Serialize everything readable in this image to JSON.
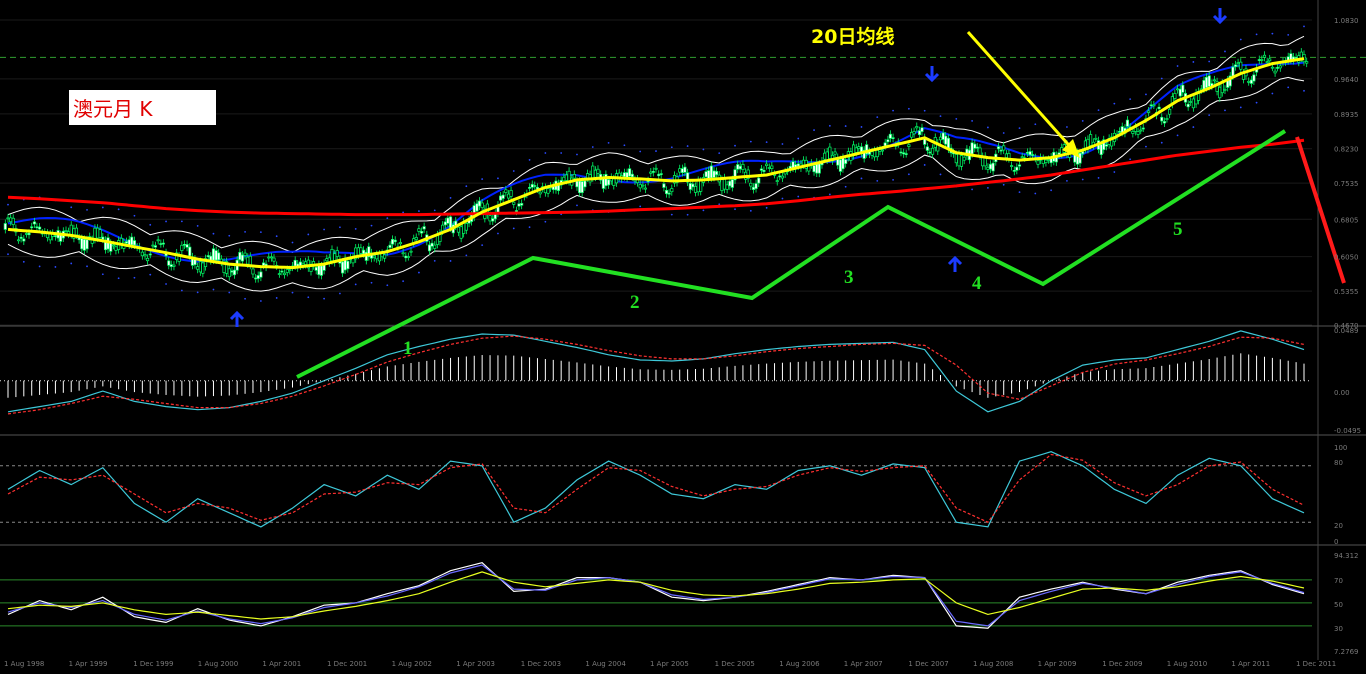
{
  "title": "澳元月 K",
  "annotation": "20日均线",
  "wave_labels": [
    "1",
    "2",
    "3",
    "4",
    "5"
  ],
  "colors": {
    "up_candle": "#00ff66",
    "ma20": "#ffff00",
    "ma_long": "#ff0000",
    "bb": "#ffffff",
    "blue_line": "#0022ff",
    "wave": "#22e022",
    "grid": "#ffffff",
    "macd_main": "#3ec8d8",
    "macd_signal": "#ff3030",
    "stoch_main": "#3ec8d8",
    "stoch_signal": "#ff3030",
    "rsi_fast": "#ffffff",
    "rsi_mid": "#6a6aff",
    "rsi_slow": "#e8ff20",
    "level_lines": "#2a8a2a"
  },
  "icons": [
    "arrow-up-icon",
    "arrow-down-icon"
  ],
  "chart_data": [
    {
      "type": "candlestick",
      "ylim": [
        0.467,
        1.083
      ],
      "x_tick_labels": [
        "1 Aug 1998",
        "1 Apr 1999",
        "1 Dec 1999",
        "1 Aug 2000",
        "1 Apr 2001",
        "1 Dec 2001",
        "1 Aug 2002",
        "1 Apr 2003",
        "1 Dec 2003",
        "1 Aug 2004",
        "1 Apr 2005",
        "1 Dec 2005",
        "1 Aug 2006",
        "1 Apr 2007",
        "1 Dec 2007",
        "1 Aug 2008",
        "1 Apr 2009",
        "1 Dec 2009",
        "1 Aug 2010",
        "1 Apr 2011",
        "1 Dec 2011"
      ],
      "y_tick_labels": [
        "1.0830",
        "0.9640",
        "0.8935",
        "0.8230",
        "0.7535",
        "0.6805",
        "0.6050",
        "0.5355",
        "0.4670"
      ],
      "current_price_line": 1.0075,
      "series": [
        {
          "name": "ma20",
          "values": [
            0.66,
            0.655,
            0.648,
            0.637,
            0.625,
            0.613,
            0.6,
            0.59,
            0.585,
            0.583,
            0.59,
            0.605,
            0.615,
            0.635,
            0.66,
            0.695,
            0.72,
            0.745,
            0.76,
            0.765,
            0.762,
            0.758,
            0.76,
            0.765,
            0.77,
            0.785,
            0.8,
            0.815,
            0.83,
            0.845,
            0.815,
            0.805,
            0.8,
            0.805,
            0.82,
            0.845,
            0.88,
            0.92,
            0.945,
            0.975,
            0.995,
            1.005
          ]
        },
        {
          "name": "ma_long",
          "values": [
            0.725,
            0.722,
            0.718,
            0.714,
            0.708,
            0.702,
            0.698,
            0.695,
            0.693,
            0.692,
            0.691,
            0.69,
            0.69,
            0.69,
            0.691,
            0.692,
            0.693,
            0.694,
            0.695,
            0.697,
            0.7,
            0.702,
            0.705,
            0.708,
            0.712,
            0.718,
            0.725,
            0.731,
            0.736,
            0.742,
            0.748,
            0.755,
            0.762,
            0.77,
            0.78,
            0.79,
            0.8,
            0.81,
            0.818,
            0.826,
            0.832,
            0.84
          ]
        }
      ]
    },
    {
      "type": "line",
      "name": "MACD",
      "ylim": [
        -0.0495,
        0.0489
      ],
      "y_tick_labels": [
        "0.0489",
        "0.00",
        "-0.0495"
      ],
      "series": [
        {
          "name": "main",
          "values": [
            -0.03,
            -0.025,
            -0.02,
            -0.01,
            -0.02,
            -0.025,
            -0.028,
            -0.026,
            -0.02,
            -0.012,
            0.0,
            0.012,
            0.025,
            0.033,
            0.04,
            0.045,
            0.044,
            0.038,
            0.032,
            0.025,
            0.02,
            0.019,
            0.021,
            0.026,
            0.03,
            0.033,
            0.035,
            0.036,
            0.037,
            0.03,
            -0.01,
            -0.03,
            -0.02,
            0.0,
            0.015,
            0.02,
            0.022,
            0.03,
            0.038,
            0.048,
            0.04,
            0.03
          ]
        },
        {
          "name": "signal",
          "values": [
            -0.032,
            -0.028,
            -0.022,
            -0.015,
            -0.018,
            -0.022,
            -0.026,
            -0.026,
            -0.022,
            -0.015,
            -0.005,
            0.006,
            0.018,
            0.027,
            0.035,
            0.041,
            0.043,
            0.04,
            0.035,
            0.029,
            0.024,
            0.021,
            0.021,
            0.024,
            0.028,
            0.031,
            0.033,
            0.035,
            0.036,
            0.034,
            0.015,
            -0.012,
            -0.018,
            -0.005,
            0.008,
            0.016,
            0.02,
            0.026,
            0.033,
            0.042,
            0.041,
            0.035
          ]
        }
      ]
    },
    {
      "type": "line",
      "name": "Stochastic",
      "ylim": [
        0,
        100
      ],
      "y_tick_labels": [
        "100",
        "80",
        "20",
        "0"
      ],
      "levels": [
        80,
        20
      ],
      "series": [
        {
          "name": "main",
          "values": [
            55,
            75,
            60,
            78,
            40,
            20,
            45,
            30,
            15,
            35,
            60,
            48,
            70,
            55,
            85,
            80,
            20,
            35,
            65,
            85,
            70,
            50,
            45,
            60,
            55,
            75,
            80,
            70,
            82,
            78,
            20,
            15,
            85,
            95,
            80,
            55,
            40,
            70,
            88,
            80,
            45,
            30
          ]
        },
        {
          "name": "signal",
          "values": [
            50,
            68,
            65,
            70,
            50,
            30,
            40,
            35,
            22,
            30,
            50,
            52,
            62,
            60,
            78,
            82,
            35,
            30,
            55,
            78,
            75,
            58,
            48,
            55,
            58,
            70,
            78,
            74,
            78,
            80,
            35,
            20,
            65,
            92,
            86,
            62,
            48,
            60,
            80,
            84,
            55,
            38
          ]
        }
      ]
    },
    {
      "type": "line",
      "name": "RSI",
      "ylim": [
        7.2769,
        94.312
      ],
      "y_tick_labels": [
        "94.312",
        "70",
        "50",
        "30",
        "7.2769"
      ],
      "levels": [
        70,
        50,
        30
      ],
      "series": [
        {
          "name": "fast",
          "values": [
            40,
            52,
            44,
            55,
            38,
            33,
            45,
            35,
            30,
            38,
            48,
            50,
            58,
            65,
            78,
            85,
            60,
            62,
            72,
            72,
            68,
            55,
            52,
            55,
            60,
            66,
            72,
            70,
            74,
            72,
            30,
            28,
            55,
            62,
            68,
            62,
            58,
            68,
            74,
            78,
            66,
            58
          ]
        },
        {
          "name": "mid",
          "values": [
            42,
            50,
            46,
            52,
            40,
            35,
            43,
            36,
            32,
            37,
            46,
            50,
            56,
            64,
            76,
            83,
            62,
            61,
            70,
            72,
            68,
            57,
            53,
            55,
            59,
            65,
            71,
            70,
            73,
            72,
            34,
            30,
            52,
            60,
            67,
            63,
            58,
            66,
            73,
            77,
            67,
            59
          ]
        },
        {
          "name": "slow",
          "values": [
            45,
            48,
            47,
            50,
            44,
            40,
            42,
            39,
            36,
            38,
            43,
            47,
            52,
            58,
            68,
            77,
            68,
            64,
            67,
            70,
            68,
            61,
            57,
            56,
            58,
            62,
            67,
            68,
            70,
            71,
            50,
            40,
            46,
            54,
            62,
            63,
            61,
            64,
            69,
            73,
            69,
            63
          ]
        }
      ]
    }
  ]
}
